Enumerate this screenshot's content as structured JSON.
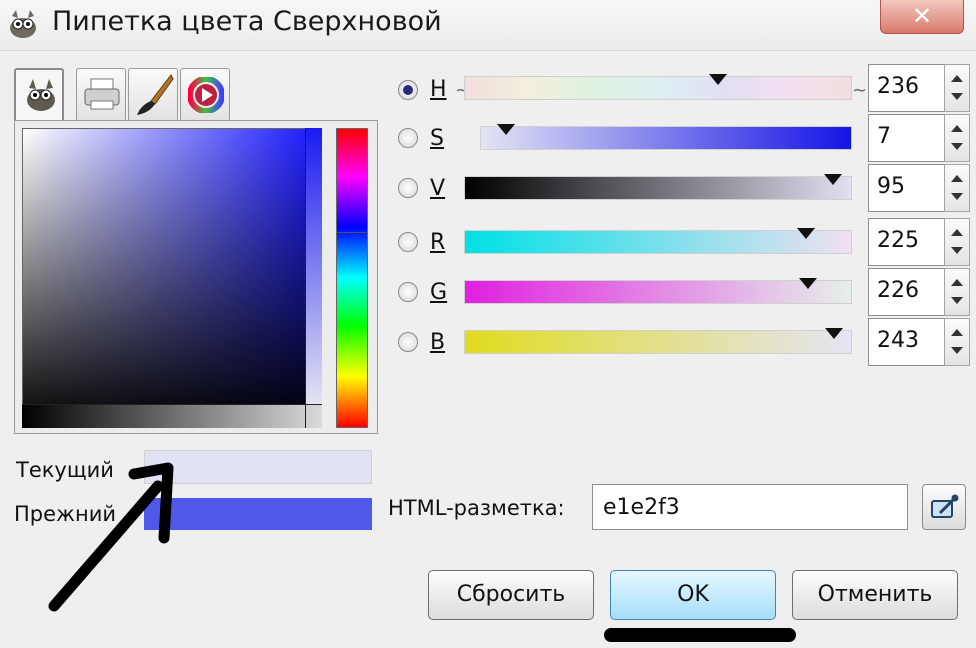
{
  "window": {
    "title": "Пипетка цвета Сверхновой",
    "close_label": "✕"
  },
  "tabs": [
    {
      "icon": "gimp-wilber-icon"
    },
    {
      "icon": "printer-icon"
    },
    {
      "icon": "paintbrush-icon"
    },
    {
      "icon": "color-wheel-icon"
    }
  ],
  "channels": [
    {
      "letter": "H",
      "value": "236",
      "level": 236,
      "max": 360,
      "selected": true
    },
    {
      "letter": "S",
      "value": "7",
      "level": 7,
      "max": 100,
      "selected": false
    },
    {
      "letter": "V",
      "value": "95",
      "level": 95,
      "max": 100,
      "selected": false
    },
    {
      "letter": "R",
      "value": "225",
      "level": 225,
      "max": 255,
      "selected": false
    },
    {
      "letter": "G",
      "value": "226",
      "level": 226,
      "max": 255,
      "selected": false
    },
    {
      "letter": "B",
      "value": "243",
      "level": 243,
      "max": 255,
      "selected": false
    }
  ],
  "swatches": {
    "current_label": "Текущий",
    "previous_label": "Прежний",
    "current_color": "#e1e2f3",
    "previous_color": "#5058ea"
  },
  "html": {
    "label": "HTML-разметка:",
    "value": "e1e2f3"
  },
  "buttons": {
    "reset": "Сбросить",
    "ok": "OK",
    "cancel": "Отменить"
  },
  "annotations": {
    "arrow": "hand-drawn-arrow",
    "underline": "hand-drawn-underline"
  }
}
